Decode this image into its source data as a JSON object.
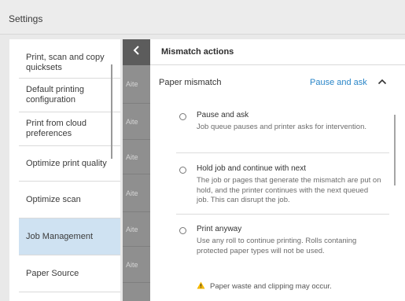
{
  "header": {
    "title": "Settings"
  },
  "sidebar": {
    "items": [
      {
        "label": "Print, scan and copy quicksets"
      },
      {
        "label": "Default printing configuration"
      },
      {
        "label": "Print from cloud preferences"
      },
      {
        "label": "Optimize print quality"
      },
      {
        "label": "Optimize scan"
      },
      {
        "label": "Job Management"
      },
      {
        "label": "Paper Source"
      }
    ],
    "selected": "Job Management"
  },
  "middle": {
    "back_icon": "chevron-left-icon",
    "rows": [
      "Aite",
      "Aite",
      "Aite",
      "Aite",
      "Aite",
      "Aite"
    ]
  },
  "panel": {
    "title": "Mismatch actions",
    "section": {
      "label": "Paper mismatch",
      "value": "Pause and ask",
      "expanded": true
    },
    "options": [
      {
        "title": "Pause and ask",
        "desc": "Job queue pauses and printer asks for intervention."
      },
      {
        "title": "Hold job and continue with next",
        "desc": "The job or pages that generate the mismatch are put on hold, and the printer continues with the next queued job. This can disrupt the job."
      },
      {
        "title": "Print anyway",
        "desc": "Use any roll to continue printing. Rolls contaning protected paper types will not be used."
      }
    ],
    "warning": "Paper waste and clipping may occur."
  },
  "colors": {
    "accent": "#2a86c8",
    "selected_bg": "#cfe2f2",
    "warning": "#f2b600"
  }
}
